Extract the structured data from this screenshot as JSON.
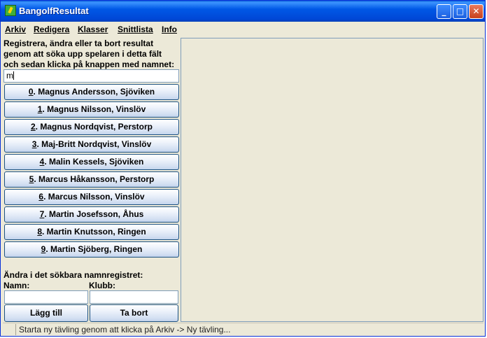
{
  "window": {
    "title": "BangolfResultat"
  },
  "menu": [
    {
      "label": "Arkiv"
    },
    {
      "label": "Redigera"
    },
    {
      "label": "Klasser"
    },
    {
      "label": "Snittlista"
    },
    {
      "label": "Info"
    }
  ],
  "left": {
    "instructions": [
      "Registrera, ändra eller ta bort resultat",
      "genom att söka upp spelaren i detta fält",
      "och sedan klicka på knappen med namnet:"
    ],
    "search_value": "m",
    "names": [
      {
        "num": "0",
        "label": ". Magnus Andersson, Sjöviken"
      },
      {
        "num": "1",
        "label": ". Magnus Nilsson, Vinslöv"
      },
      {
        "num": "2",
        "label": ". Magnus Nordqvist, Perstorp"
      },
      {
        "num": "3",
        "label": ". Maj-Britt Nordqvist, Vinslöv"
      },
      {
        "num": "4",
        "label": ". Malin Kessels, Sjöviken"
      },
      {
        "num": "5",
        "label": ". Marcus Håkansson, Perstorp"
      },
      {
        "num": "6",
        "label": ". Marcus Nilsson, Vinslöv"
      },
      {
        "num": "7",
        "label": ". Martin Josefsson, Åhus"
      },
      {
        "num": "8",
        "label": ". Martin Knutsson, Ringen"
      },
      {
        "num": "9",
        "label": ". Martin Sjöberg, Ringen"
      }
    ],
    "register_label": "Ändra i det sökbara namnregistret:",
    "namn_label": "Namn:",
    "klubb_label": "Klubb:",
    "namn_value": "",
    "klubb_value": "",
    "add_button": "Lägg till",
    "delete_button": "Ta bort"
  },
  "status": {
    "text": "Starta ny tävling genom att klicka på Arkiv -> Ny tävling..."
  }
}
